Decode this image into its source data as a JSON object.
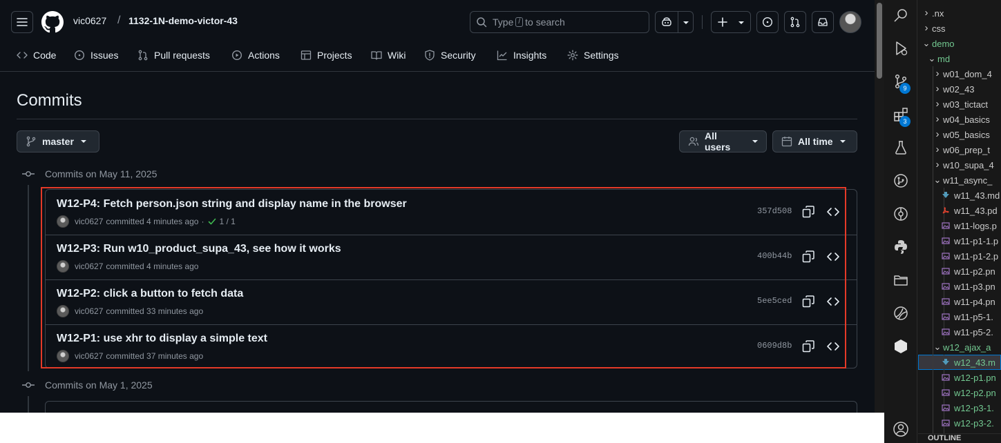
{
  "github": {
    "owner": "vic0627",
    "separator": "/",
    "repo": "1132-1N-demo-victor-43",
    "search": {
      "prefix": "Type",
      "key": "/",
      "suffix": "to search"
    },
    "nav": [
      {
        "label": "Code",
        "icon": "code-icon"
      },
      {
        "label": "Issues",
        "icon": "issue-icon"
      },
      {
        "label": "Pull requests",
        "icon": "pull-request-icon"
      },
      {
        "label": "Actions",
        "icon": "play-icon"
      },
      {
        "label": "Projects",
        "icon": "table-icon"
      },
      {
        "label": "Wiki",
        "icon": "book-icon"
      },
      {
        "label": "Security",
        "icon": "shield-icon"
      },
      {
        "label": "Insights",
        "icon": "graph-icon"
      },
      {
        "label": "Settings",
        "icon": "gear-icon"
      }
    ],
    "page_title": "Commits",
    "branch_button": "master",
    "users_button": "All users",
    "time_button": "All time",
    "groups": [
      {
        "heading": "Commits on May 11, 2025",
        "commits": [
          {
            "title": "W12-P4: Fetch person.json string and display name in the browser",
            "author": "vic0627",
            "time": "committed 4 minutes ago",
            "status": "1 / 1",
            "sha": "357d508"
          },
          {
            "title": "W12-P3: Run w10_product_supa_43, see how it works",
            "author": "vic0627",
            "time": "committed 4 minutes ago",
            "status": "",
            "sha": "400b44b"
          },
          {
            "title": "W12-P2: click a button to fetch data",
            "author": "vic0627",
            "time": "committed 33 minutes ago",
            "status": "",
            "sha": "5ee5ced"
          },
          {
            "title": "W12-P1: use xhr to display a simple text",
            "author": "vic0627",
            "time": "committed 37 minutes ago",
            "status": "",
            "sha": "0609d8b"
          }
        ]
      },
      {
        "heading": "Commits on May 1, 2025"
      }
    ],
    "accent": "#e53a28"
  },
  "vscode": {
    "badges": {
      "source_control": "9",
      "extensions": "3"
    },
    "tree": [
      {
        "label": ".nx",
        "depth": 0,
        "type": "folder",
        "open": false
      },
      {
        "label": "css",
        "depth": 0,
        "type": "folder",
        "open": false
      },
      {
        "label": "demo",
        "depth": 0,
        "type": "folder",
        "open": true,
        "color": "#73c991"
      },
      {
        "label": "md",
        "depth": 1,
        "type": "folder",
        "open": true,
        "color": "#73c991"
      },
      {
        "label": "w01_dom_4",
        "depth": 2,
        "type": "folder",
        "open": false
      },
      {
        "label": "w02_43",
        "depth": 2,
        "type": "folder",
        "open": false
      },
      {
        "label": "w03_tictact",
        "depth": 2,
        "type": "folder",
        "open": false
      },
      {
        "label": "w04_basics",
        "depth": 2,
        "type": "folder",
        "open": false
      },
      {
        "label": "w05_basics",
        "depth": 2,
        "type": "folder",
        "open": false
      },
      {
        "label": "w06_prep_t",
        "depth": 2,
        "type": "folder",
        "open": false
      },
      {
        "label": "w10_supa_4",
        "depth": 2,
        "type": "folder",
        "open": false
      },
      {
        "label": "w11_async_",
        "depth": 2,
        "type": "folder",
        "open": true
      },
      {
        "label": "w11_43.md",
        "depth": 3,
        "type": "md"
      },
      {
        "label": "w11_43.pd",
        "depth": 3,
        "type": "pdf"
      },
      {
        "label": "w11-logs.p",
        "depth": 3,
        "type": "img"
      },
      {
        "label": "w11-p1-1.p",
        "depth": 3,
        "type": "img"
      },
      {
        "label": "w11-p1-2.p",
        "depth": 3,
        "type": "img"
      },
      {
        "label": "w11-p2.pn",
        "depth": 3,
        "type": "img"
      },
      {
        "label": "w11-p3.pn",
        "depth": 3,
        "type": "img"
      },
      {
        "label": "w11-p4.pn",
        "depth": 3,
        "type": "img"
      },
      {
        "label": "w11-p5-1.",
        "depth": 3,
        "type": "img"
      },
      {
        "label": "w11-p5-2.",
        "depth": 3,
        "type": "img"
      },
      {
        "label": "w12_ajax_a",
        "depth": 2,
        "type": "folder",
        "open": true,
        "color": "#73c991"
      },
      {
        "label": "w12_43.m",
        "depth": 3,
        "type": "md",
        "color": "#73c991"
      },
      {
        "label": "w12-p1.pn",
        "depth": 3,
        "type": "img",
        "color": "#73c991"
      },
      {
        "label": "w12-p2.pn",
        "depth": 3,
        "type": "img",
        "color": "#73c991"
      },
      {
        "label": "w12-p3-1.",
        "depth": 3,
        "type": "img",
        "color": "#73c991"
      },
      {
        "label": "w12-p3-2.",
        "depth": 3,
        "type": "img",
        "color": "#73c991"
      }
    ],
    "outline_label": "OUTLINE"
  }
}
